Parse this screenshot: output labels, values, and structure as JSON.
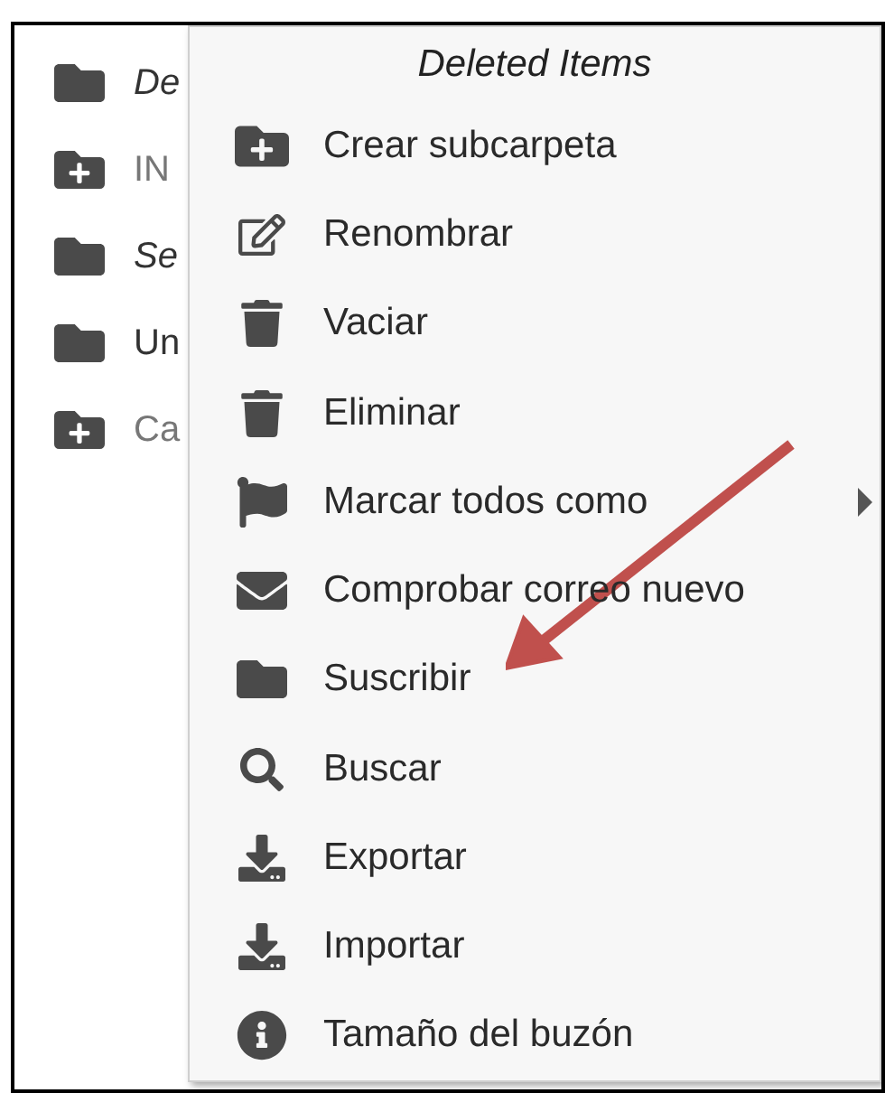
{
  "folders": [
    {
      "name": "De",
      "kind": "special"
    },
    {
      "name": "IN",
      "kind": "shared"
    },
    {
      "name": "Se",
      "kind": "special"
    },
    {
      "name": "Un",
      "kind": "normal"
    },
    {
      "name": "Ca",
      "kind": "shared"
    }
  ],
  "context_menu": {
    "title": "Deleted Items",
    "items": [
      {
        "label": "Crear subcarpeta",
        "kind": "create-folder",
        "submenu": false
      },
      {
        "label": "Renombrar",
        "kind": "rename",
        "submenu": false
      },
      {
        "label": "Vaciar",
        "kind": "empty",
        "submenu": false
      },
      {
        "label": "Eliminar",
        "kind": "delete",
        "submenu": false
      },
      {
        "label": "Marcar todos como",
        "kind": "mark",
        "submenu": true
      },
      {
        "label": "Comprobar correo nuevo",
        "kind": "check-mail",
        "submenu": false
      },
      {
        "label": "Suscribir",
        "kind": "subscribe",
        "submenu": false
      },
      {
        "label": "Buscar",
        "kind": "search",
        "submenu": false
      },
      {
        "label": "Exportar",
        "kind": "export",
        "submenu": false
      },
      {
        "label": "Importar",
        "kind": "import",
        "submenu": false
      },
      {
        "label": "Tamaño del buzón",
        "kind": "size",
        "submenu": false
      }
    ]
  }
}
